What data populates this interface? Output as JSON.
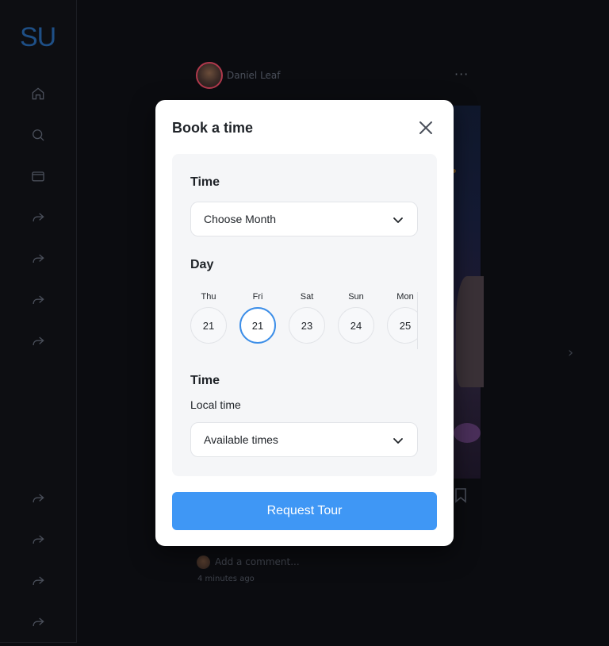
{
  "sidebar": {
    "logo": "SU",
    "items": [
      {
        "icon": "home-icon"
      },
      {
        "icon": "search-icon"
      },
      {
        "icon": "wallet-icon"
      },
      {
        "icon": "share-icon"
      },
      {
        "icon": "share-icon"
      },
      {
        "icon": "share-icon"
      },
      {
        "icon": "share-icon"
      },
      {
        "icon": "share-icon"
      },
      {
        "icon": "share-icon"
      },
      {
        "icon": "share-icon"
      },
      {
        "icon": "share-icon"
      }
    ]
  },
  "feed": {
    "username": "Daniel Leaf",
    "more": "···",
    "comment_placeholder": "Add a comment...",
    "time_ago": "4 minutes ago"
  },
  "modal": {
    "title": "Book a time",
    "month_label": "Time",
    "month_select": "Choose Month",
    "day_label": "Day",
    "days": [
      {
        "name": "Thu",
        "num": "21",
        "selected": false
      },
      {
        "name": "Fri",
        "num": "21",
        "selected": true
      },
      {
        "name": "Sat",
        "num": "23",
        "selected": false
      },
      {
        "name": "Sun",
        "num": "24",
        "selected": false
      },
      {
        "name": "Mon",
        "num": "25",
        "selected": false
      }
    ],
    "time_label": "Time",
    "local_time_label": "Local time",
    "time_select": "Available times",
    "submit_label": "Request Tour"
  },
  "colors": {
    "accent": "#3f97f5",
    "selected_ring": "#3c8ee8",
    "logo": "#1e4f86"
  }
}
